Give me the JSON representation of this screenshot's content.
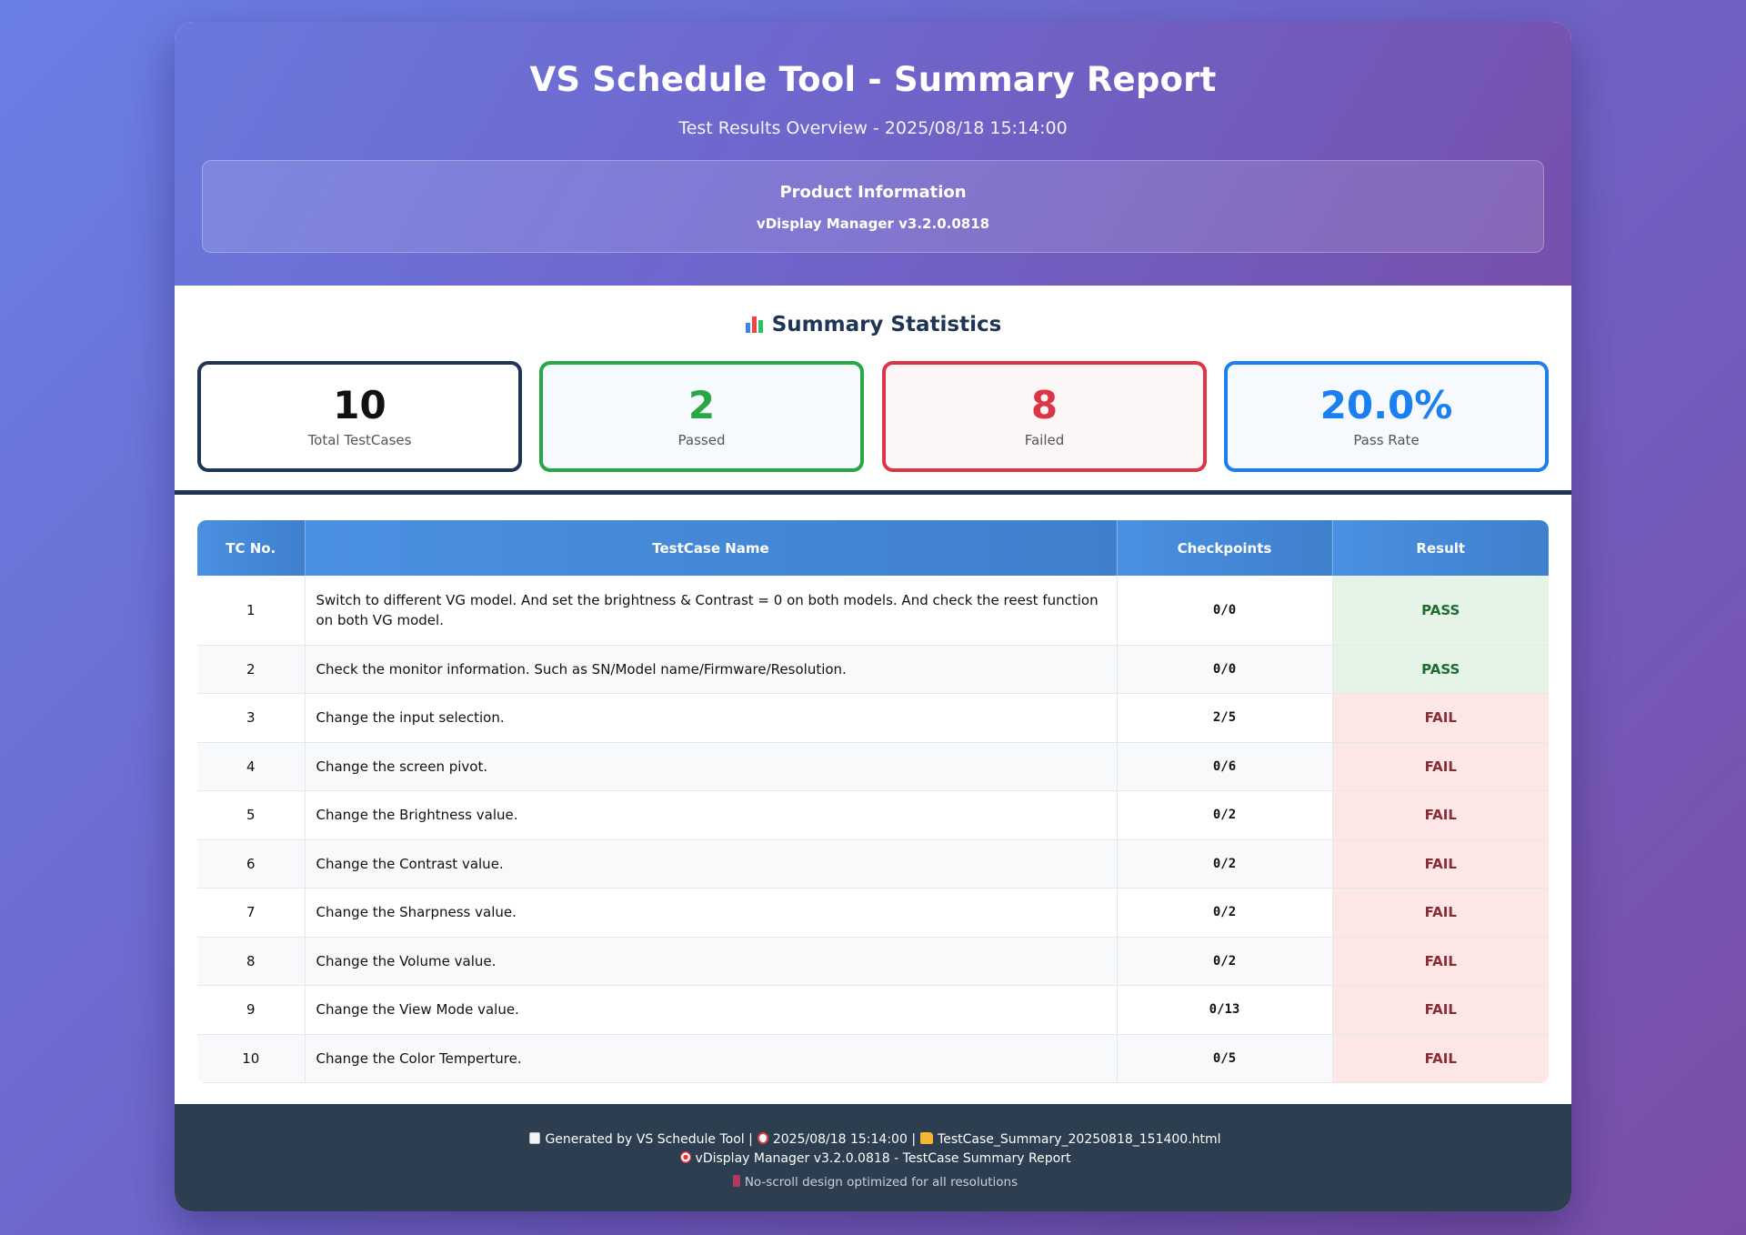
{
  "header": {
    "title": "VS Schedule Tool - Summary Report",
    "subtitle": "Test Results Overview - 2025/08/18 15:14:00",
    "product_label": "Product Information",
    "product_value": "vDisplay Manager v3.2.0.0818"
  },
  "stats": {
    "title": "Summary Statistics",
    "icon": "bar-chart-icon",
    "total": {
      "value": "10",
      "label": "Total TestCases"
    },
    "passed": {
      "value": "2",
      "label": "Passed"
    },
    "failed": {
      "value": "8",
      "label": "Failed"
    },
    "pass_rate": {
      "value": "20.0%",
      "label": "Pass Rate"
    }
  },
  "table": {
    "headers": [
      "TC No.",
      "TestCase Name",
      "Checkpoints",
      "Result"
    ],
    "rows": [
      {
        "no": "1",
        "name": "Switch to different VG model. And set the brightness & Contrast = 0 on both models. And check the reest function on both VG model.",
        "checkpoints": "0/0",
        "result": "PASS"
      },
      {
        "no": "2",
        "name": "Check the monitor information. Such as SN/Model name/Firmware/Resolution.",
        "checkpoints": "0/0",
        "result": "PASS"
      },
      {
        "no": "3",
        "name": "Change the input selection.",
        "checkpoints": "2/5",
        "result": "FAIL"
      },
      {
        "no": "4",
        "name": "Change the screen pivot.",
        "checkpoints": "0/6",
        "result": "FAIL"
      },
      {
        "no": "5",
        "name": "Change the Brightness value.",
        "checkpoints": "0/2",
        "result": "FAIL"
      },
      {
        "no": "6",
        "name": "Change the Contrast value.",
        "checkpoints": "0/2",
        "result": "FAIL"
      },
      {
        "no": "7",
        "name": "Change the Sharpness value.",
        "checkpoints": "0/2",
        "result": "FAIL"
      },
      {
        "no": "8",
        "name": "Change the Volume value.",
        "checkpoints": "0/2",
        "result": "FAIL"
      },
      {
        "no": "9",
        "name": "Change the View Mode value.",
        "checkpoints": "0/13",
        "result": "FAIL"
      },
      {
        "no": "10",
        "name": "Change the Color Temperture.",
        "checkpoints": "0/5",
        "result": "FAIL"
      }
    ]
  },
  "footer": {
    "generated": "Generated by VS Schedule Tool |",
    "timestamp": "2025/08/18 15:14:00 |",
    "filename": "TestCase_Summary_20250818_151400.html",
    "report_line": "vDisplay Manager v3.2.0.0818 - TestCase Summary Report",
    "design_note": "No-scroll design optimized for all resolutions"
  },
  "colors": {
    "pass": "#28a745",
    "fail": "#dc3545",
    "rate": "#1a7ff0",
    "navy": "#1e3556",
    "table_header": "#4a90e2",
    "footer_bg": "#2c3e50"
  }
}
